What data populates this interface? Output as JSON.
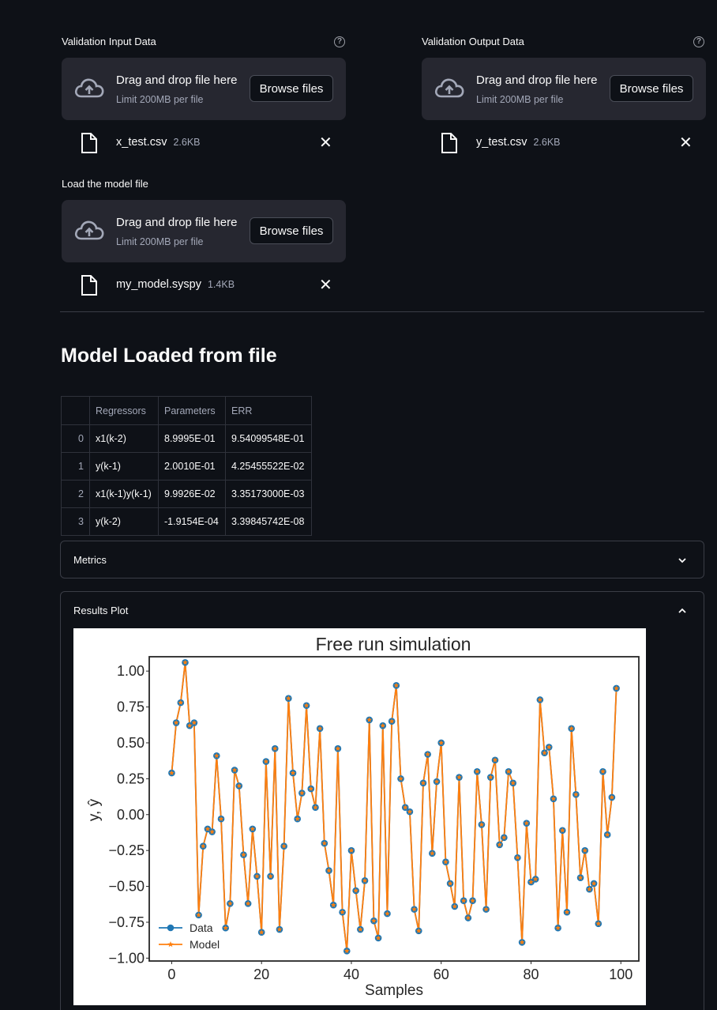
{
  "uploaders": {
    "input": {
      "label": "Validation Input Data",
      "drop_text": "Drag and drop file here",
      "limit_text": "Limit 200MB per file",
      "browse_label": "Browse files",
      "help_icon": "?",
      "file": {
        "name": "x_test.csv",
        "size": "2.6KB"
      }
    },
    "output": {
      "label": "Validation Output Data",
      "drop_text": "Drag and drop file here",
      "limit_text": "Limit 200MB per file",
      "browse_label": "Browse files",
      "help_icon": "?",
      "file": {
        "name": "y_test.csv",
        "size": "2.6KB"
      }
    },
    "model": {
      "label": "Load the model file",
      "drop_text": "Drag and drop file here",
      "limit_text": "Limit 200MB per file",
      "browse_label": "Browse files",
      "file": {
        "name": "my_model.syspy",
        "size": "1.4KB"
      }
    }
  },
  "remove_icon": "✕",
  "heading": "Model Loaded from file",
  "table": {
    "columns": [
      "Regressors",
      "Parameters",
      "ERR"
    ],
    "rows": [
      {
        "index": "0",
        "cells": [
          "x1(k-2)",
          "8.9995E-01",
          "9.54099548E-01"
        ]
      },
      {
        "index": "1",
        "cells": [
          "y(k-1)",
          "2.0010E-01",
          "4.25455522E-02"
        ]
      },
      {
        "index": "2",
        "cells": [
          "x1(k-1)y(k-1)",
          "9.9926E-02",
          "3.35173000E-03"
        ]
      },
      {
        "index": "3",
        "cells": [
          "y(k-2)",
          "-1.9154E-04",
          "3.39845742E-08"
        ]
      }
    ]
  },
  "expanders": {
    "metrics": {
      "title": "Metrics",
      "state": "collapsed",
      "icon": "chevron-down-icon"
    },
    "results": {
      "title": "Results Plot",
      "state": "expanded",
      "icon": "chevron-up-icon"
    }
  },
  "colors": {
    "data": "#1f77b4",
    "model": "#ff7f0e",
    "bg": "#0e1117",
    "panel": "#262730"
  },
  "chart_data": {
    "type": "line",
    "title": "Free run simulation",
    "xlabel": "Samples",
    "ylabel": "y, ŷ",
    "xlim": [
      -5,
      104
    ],
    "ylim": [
      -1.02,
      1.1
    ],
    "xticks": [
      "0",
      "20",
      "40",
      "60",
      "80",
      "100"
    ],
    "yticks": [
      "1.00",
      "0.75",
      "0.50",
      "0.25",
      "0.00",
      "−0.25",
      "−0.50",
      "−0.75",
      "−1.00"
    ],
    "legend_position": "lower-left",
    "x": [
      0,
      1,
      2,
      3,
      4,
      5,
      6,
      7,
      8,
      9,
      10,
      11,
      12,
      13,
      14,
      15,
      16,
      17,
      18,
      19,
      20,
      21,
      22,
      23,
      24,
      25,
      26,
      27,
      28,
      29,
      30,
      31,
      32,
      33,
      34,
      35,
      36,
      37,
      38,
      39,
      40,
      41,
      42,
      43,
      44,
      45,
      46,
      47,
      48,
      49,
      50,
      51,
      52,
      53,
      54,
      55,
      56,
      57,
      58,
      59,
      60,
      61,
      62,
      63,
      64,
      65,
      66,
      67,
      68,
      69,
      70,
      71,
      72,
      73,
      74,
      75,
      76,
      77,
      78,
      79,
      80,
      81,
      82,
      83,
      84,
      85,
      86,
      87,
      88,
      89,
      90,
      91,
      92,
      93,
      94,
      95,
      96,
      97,
      98,
      99,
      100
    ],
    "series": [
      {
        "name": "Data",
        "marker": "circle",
        "values": [
          0.29,
          0.64,
          0.78,
          1.06,
          0.62,
          0.64,
          -0.7,
          -0.22,
          -0.1,
          -0.12,
          0.41,
          -0.03,
          -0.79,
          -0.62,
          0.31,
          0.2,
          -0.28,
          -0.62,
          -0.1,
          -0.43,
          -0.82,
          0.37,
          -0.43,
          0.46,
          -0.8,
          -0.22,
          0.81,
          0.29,
          -0.03,
          0.15,
          0.76,
          0.18,
          0.05,
          0.6,
          -0.2,
          -0.39,
          -0.63,
          0.46,
          -0.68,
          -0.95,
          -0.25,
          -0.53,
          -0.8,
          -0.46,
          0.66,
          -0.74,
          -0.86,
          0.62,
          -0.69,
          0.65,
          0.9,
          0.25,
          0.05,
          0.02,
          -0.66,
          -0.81,
          0.22,
          0.42,
          -0.27,
          0.23,
          0.5,
          -0.33,
          -0.48,
          -0.64,
          0.26,
          -0.6,
          -0.72,
          -0.6,
          0.3,
          -0.07,
          -0.66,
          0.26,
          0.38,
          -0.21,
          -0.16,
          0.3,
          0.22,
          -0.3,
          -0.89,
          -0.06,
          -0.47,
          -0.45,
          0.8,
          0.43,
          0.47,
          0.11,
          -0.79,
          -0.11,
          -0.68,
          0.6,
          0.14,
          -0.44,
          -0.25,
          -0.52,
          -0.48,
          -0.76,
          0.3,
          -0.14,
          0.12,
          0.88
        ]
      },
      {
        "name": "Model",
        "marker": "star",
        "values": [
          0.29,
          0.64,
          0.78,
          1.06,
          0.62,
          0.64,
          -0.7,
          -0.22,
          -0.1,
          -0.12,
          0.41,
          -0.03,
          -0.79,
          -0.62,
          0.31,
          0.2,
          -0.28,
          -0.62,
          -0.1,
          -0.43,
          -0.82,
          0.37,
          -0.43,
          0.46,
          -0.8,
          -0.22,
          0.81,
          0.29,
          -0.03,
          0.15,
          0.76,
          0.18,
          0.05,
          0.6,
          -0.2,
          -0.39,
          -0.63,
          0.46,
          -0.68,
          -0.95,
          -0.25,
          -0.53,
          -0.8,
          -0.46,
          0.66,
          -0.74,
          -0.86,
          0.62,
          -0.69,
          0.65,
          0.9,
          0.25,
          0.05,
          0.02,
          -0.66,
          -0.81,
          0.22,
          0.42,
          -0.27,
          0.23,
          0.5,
          -0.33,
          -0.48,
          -0.64,
          0.26,
          -0.6,
          -0.72,
          -0.6,
          0.3,
          -0.07,
          -0.66,
          0.26,
          0.38,
          -0.21,
          -0.16,
          0.3,
          0.22,
          -0.3,
          -0.89,
          -0.06,
          -0.47,
          -0.45,
          0.8,
          0.43,
          0.47,
          0.11,
          -0.79,
          -0.11,
          -0.68,
          0.6,
          0.14,
          -0.44,
          -0.25,
          -0.52,
          -0.48,
          -0.76,
          0.3,
          -0.14,
          0.12,
          0.88
        ]
      }
    ]
  }
}
